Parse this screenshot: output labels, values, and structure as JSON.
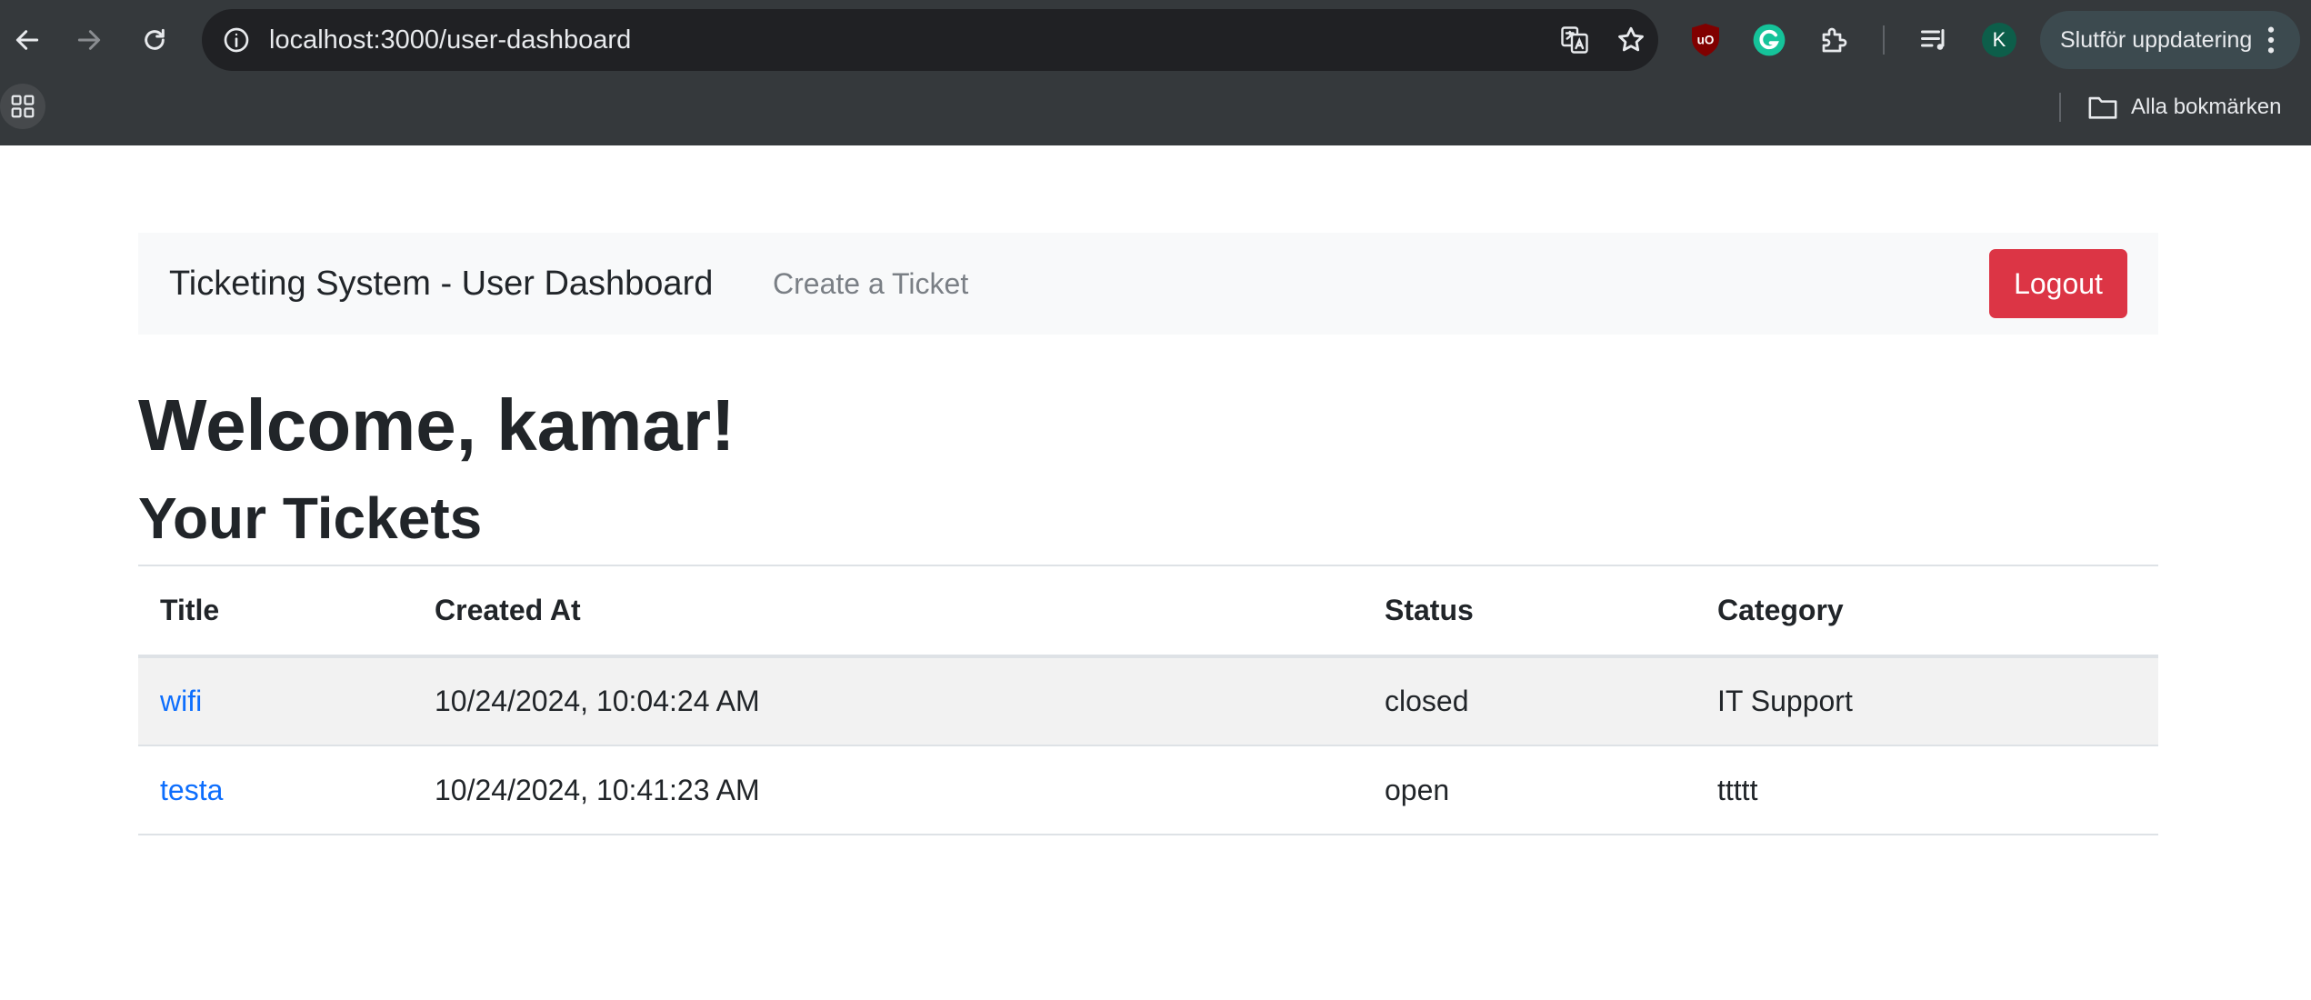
{
  "browser": {
    "url": "localhost:3000/user-dashboard",
    "profile_initial": "K",
    "update_label": "Slutför uppdatering",
    "bookmarks_label": "Alla bokmärken",
    "icons": [
      "back-arrow-icon",
      "forward-arrow-icon",
      "reload-icon",
      "site-info-icon",
      "translate-icon",
      "bookmark-star-icon",
      "ublock-icon",
      "grammarly-icon",
      "extensions-puzzle-icon",
      "media-queue-icon",
      "kebab-menu-icon",
      "apps-grid-icon",
      "folder-icon"
    ]
  },
  "navbar": {
    "brand": "Ticketing System - User Dashboard",
    "create_link": "Create a Ticket",
    "logout_label": "Logout"
  },
  "page": {
    "welcome": "Welcome, kamar!",
    "subtitle": "Your Tickets"
  },
  "table": {
    "headers": [
      "Title",
      "Created At",
      "Status",
      "Category"
    ],
    "rows": [
      {
        "title": "wifi",
        "created_at": "10/24/2024, 10:04:24 AM",
        "status": "closed",
        "category": "IT Support"
      },
      {
        "title": "testa",
        "created_at": "10/24/2024, 10:41:23 AM",
        "status": "open",
        "category": "ttttt"
      }
    ]
  },
  "colors": {
    "chrome_bg": "#35393c",
    "omnibox_bg": "#202124",
    "navbar_bg": "#f8f9fa",
    "danger": "#dc3545",
    "link": "#0d6efd",
    "stripe": "#f2f2f2"
  }
}
